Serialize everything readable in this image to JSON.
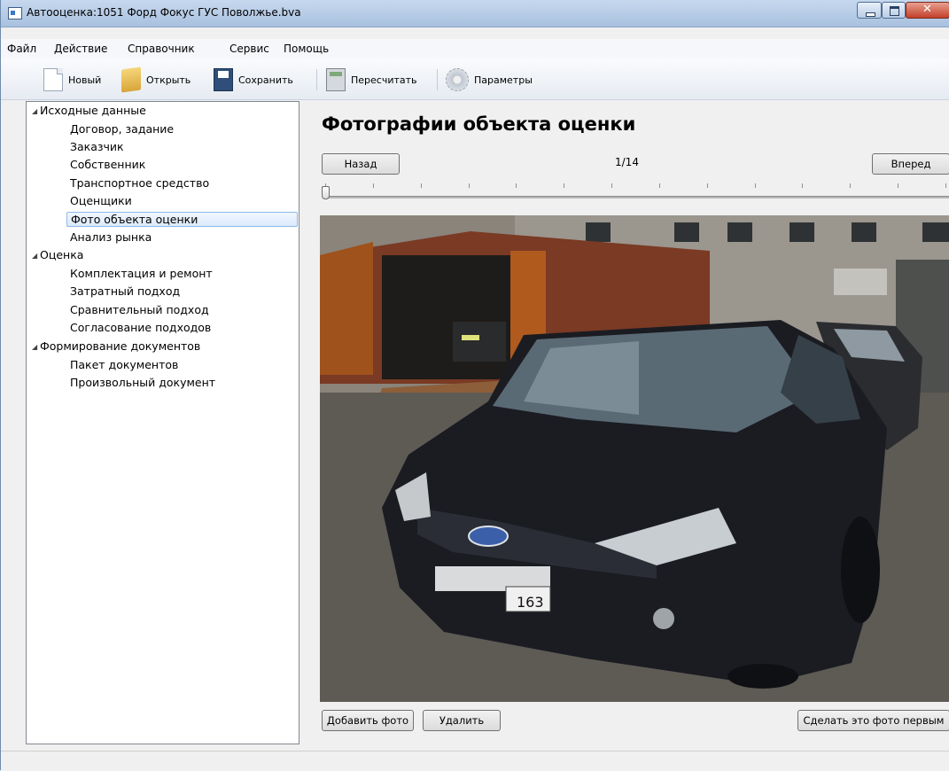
{
  "window": {
    "title": "Автооценка:1051 Форд Фокус ГУС Поволжье.bva"
  },
  "menu": [
    "Файл",
    "Действие",
    "Справочник",
    "Сервис",
    "Помощь"
  ],
  "toolbar": {
    "new_label": "Новый",
    "open_label": "Открыть",
    "save_label": "Сохранить",
    "recalc_label": "Пересчитать",
    "params_label": "Параметры"
  },
  "tree": {
    "groups": [
      {
        "label": "Исходные данные",
        "items": [
          "Договор, задание",
          "Заказчик",
          "Собственник",
          "Транспортное средство",
          "Оценщики",
          "Фото объекта оценки",
          "Анализ рынка"
        ]
      },
      {
        "label": "Оценка",
        "items": [
          "Комплектация и ремонт",
          "Затратный подход",
          "Сравнительный подход",
          "Согласование подходов"
        ]
      },
      {
        "label": "Формирование документов",
        "items": [
          "Пакет документов",
          "Произвольный документ"
        ]
      }
    ],
    "selected": "Фото объекта оценки"
  },
  "main": {
    "title": "Фотографии объекта оценки",
    "back_label": "Назад",
    "forward_label": "Вперед",
    "counter": "1/14",
    "slider_position": 1,
    "slider_total": 14,
    "add_photo_label": "Добавить фото",
    "delete_label": "Удалить",
    "make_first_label": "Сделать это фото первым",
    "plate_number": "163"
  }
}
